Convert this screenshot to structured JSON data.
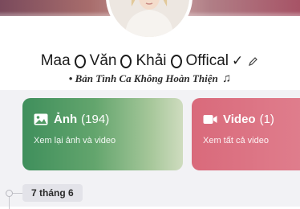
{
  "profile": {
    "name_parts": [
      "Maa",
      "Văn",
      "Khải",
      "Offical"
    ],
    "verified_glyph": "✓",
    "bio": "• Bản Tình Ca Không Hoàn Thiện",
    "bio_glyph": "♫"
  },
  "albums": [
    {
      "title": "Ảnh",
      "count": "(194)",
      "subtitle": "Xem lại ảnh và video",
      "icon": "image-icon",
      "color": "#4f9a64"
    },
    {
      "title": "Video",
      "count": "(1)",
      "subtitle": "Xem tất cả video",
      "icon": "video-camera-icon",
      "color": "#dc7383"
    }
  ],
  "timeline": {
    "date": "7 tháng 6"
  }
}
